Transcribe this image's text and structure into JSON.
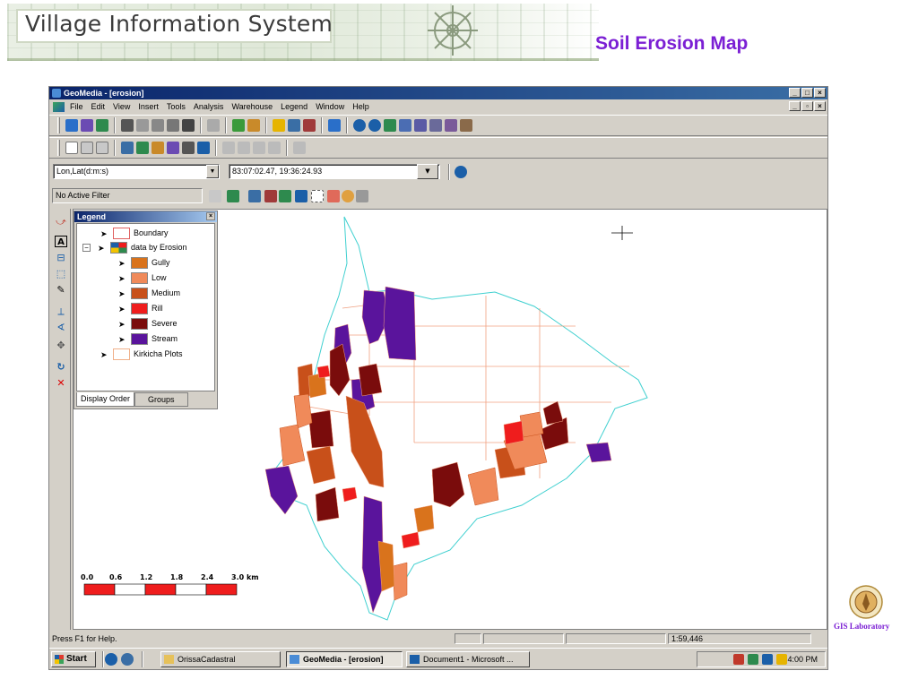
{
  "slide": {
    "banner_title": "Village Information System",
    "title": "Soil Erosion Map",
    "title_color": "#7b1fd4"
  },
  "window": {
    "title": "GeoMedia - [erosion]",
    "menu": [
      "File",
      "Edit",
      "View",
      "Insert",
      "Tools",
      "Analysis",
      "Warehouse",
      "Legend",
      "Window",
      "Help"
    ]
  },
  "coordinates": {
    "system": "Lon,Lat(d:m:s)",
    "value": "83:07:02.47, 19:36:24.93"
  },
  "filter": {
    "label": "No Active Filter"
  },
  "legend": {
    "title": "Legend",
    "items": [
      {
        "label": "Boundary",
        "color": "#ffffff",
        "outline": "#e06060",
        "indent": 0
      },
      {
        "label": "data by Erosion",
        "color": "multicolor",
        "indent": 0
      },
      {
        "label": "Gully",
        "color": "#d9731c",
        "indent": 1
      },
      {
        "label": "Low",
        "color": "#f08a5a",
        "indent": 1
      },
      {
        "label": "Medium",
        "color": "#c8501a",
        "indent": 1
      },
      {
        "label": "Rill",
        "color": "#ef1d1d",
        "indent": 1
      },
      {
        "label": "Severe",
        "color": "#7a0c0c",
        "indent": 1
      },
      {
        "label": "Stream",
        "color": "#5a149c",
        "indent": 1
      },
      {
        "label": "Kirkicha Plots",
        "color": "#ffffff",
        "outline": "#f0b08a",
        "indent": 0
      }
    ],
    "tabs": [
      "Display Order",
      "Groups"
    ]
  },
  "scale_bar": {
    "ticks": [
      "0.0",
      "0.6",
      "1.2",
      "1.8",
      "2.4",
      "3.0 km"
    ]
  },
  "status": {
    "help_text": "Press F1 for Help.",
    "scale": "1:59,446"
  },
  "taskbar": {
    "start": "Start",
    "tasks": [
      "OrissaCadastral",
      "GeoMedia - [erosion]",
      "Document1 - Microsoft ..."
    ],
    "clock": "4:00 PM"
  },
  "gis_lab": {
    "label": "GIS Laboratory"
  }
}
